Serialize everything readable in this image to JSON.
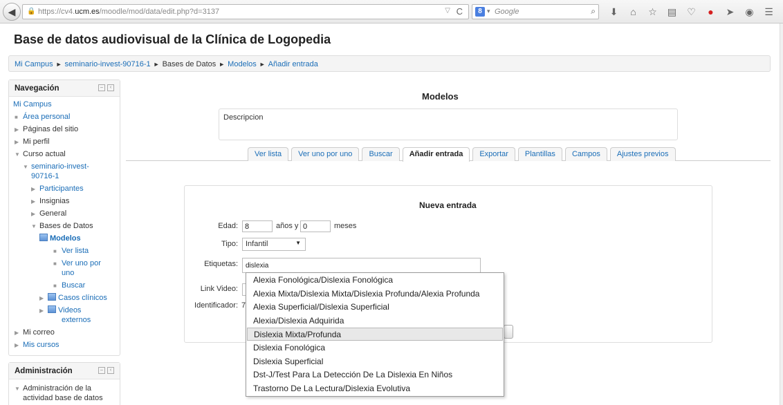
{
  "browser": {
    "url_prefix": "https://cv4.",
    "url_domain": "ucm.es",
    "url_path": "/moodle/mod/data/edit.php?d=3137",
    "search_engine_label": "8",
    "search_placeholder": "Google"
  },
  "page": {
    "title": "Base de datos audiovisual de la Clínica de Logopedia"
  },
  "breadcrumb": [
    "Mi Campus",
    "seminario-invest-90716-1",
    "Bases de Datos",
    "Modelos",
    "Añadir entrada"
  ],
  "navigation": {
    "title": "Navegación",
    "items": {
      "mi_campus": "Mi Campus",
      "area_personal": "Área personal",
      "paginas_sitio": "Páginas del sitio",
      "mi_perfil": "Mi perfil",
      "curso_actual": "Curso actual",
      "course_line1": "seminario-invest-",
      "course_line2": "90716-1",
      "participantes": "Participantes",
      "insignias": "Insignias",
      "general": "General",
      "bases_datos": "Bases de Datos",
      "modelos": "Modelos",
      "ver_lista": "Ver lista",
      "ver_uno_1": "Ver uno por",
      "ver_uno_2": "uno",
      "buscar": "Buscar",
      "casos_clinicos": "Casos clínicos",
      "videos_1": "Videos",
      "videos_2": "externos",
      "mi_correo": "Mi correo",
      "mis_cursos": "Mis cursos"
    }
  },
  "administration": {
    "title": "Administración",
    "item_line1": "Administración de la",
    "item_line2": "actividad base de datos"
  },
  "main": {
    "heading": "Modelos",
    "description": "Descripcion",
    "tabs": [
      "Ver lista",
      "Ver uno por uno",
      "Buscar",
      "Añadir entrada",
      "Exportar",
      "Plantillas",
      "Campos",
      "Ajustes previos"
    ],
    "active_tab": "Añadir entrada"
  },
  "form": {
    "title": "Nueva entrada",
    "edad_label": "Edad:",
    "edad_years": "8",
    "years_text": "años y",
    "edad_months": "0",
    "months_text": "meses",
    "tipo_label": "Tipo:",
    "tipo_value": "Infantil",
    "etiquetas_label": "Etiquetas:",
    "etiquetas_value": "dislexia",
    "link_video_label": "Link Video:",
    "identificador_label": "Identificador:",
    "identificador_partial": "7"
  },
  "autocomplete": {
    "items": [
      "Alexia Fonológica/Dislexia Fonológica",
      "Alexia Mixta/Dislexia  Mixta/Dislexia Profunda/Alexia Profunda",
      "Alexia Superficial/Dislexia Superficial",
      "Alexia/Dislexia Adquirida",
      "Dislexia  Mixta/Profunda",
      "Dislexia Fonológica",
      "Dislexia Superficial",
      "Dst-J/Test Para La Detección De La Dislexia En Niños",
      "Trastorno De La Lectura/Dislexia Evolutiva"
    ],
    "highlighted": "Dislexia  Mixta/Profunda"
  }
}
